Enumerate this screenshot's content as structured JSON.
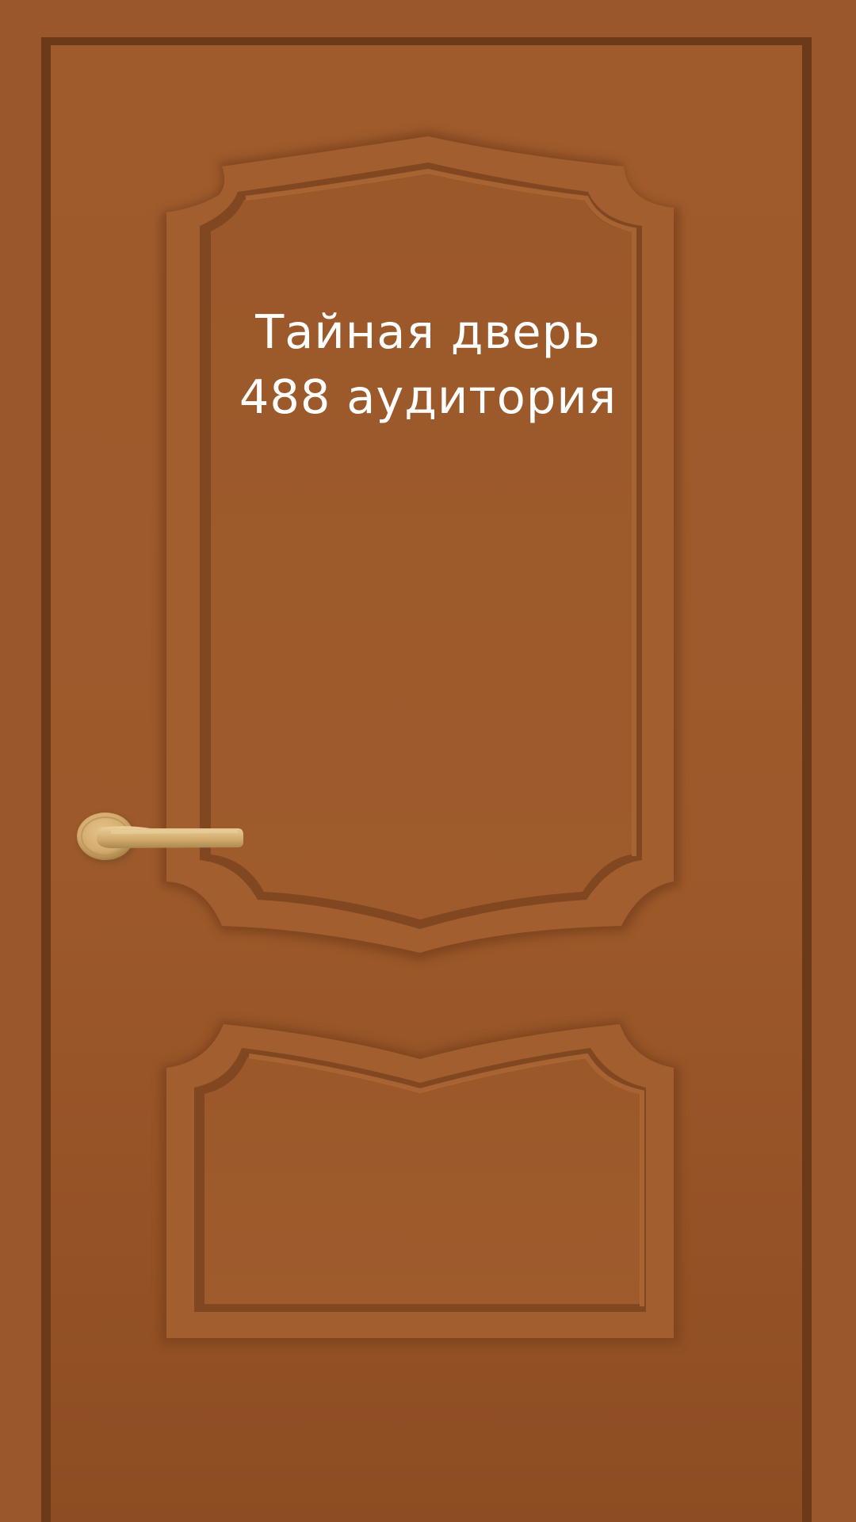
{
  "door": {
    "title_line_1": "Тайная дверь",
    "title_line_2": "488 аудитория"
  },
  "colors": {
    "wall": "#9a572b",
    "frame": "#6e3d1b",
    "door_face": "#9e5a2c",
    "panel_shadow": "#7a421c",
    "panel_highlight": "#b56f3a",
    "handle": "#d9b47a",
    "handle_shadow": "#9a7a45",
    "text": "#ffffff"
  },
  "icons": {
    "handle": "door-handle-icon"
  }
}
